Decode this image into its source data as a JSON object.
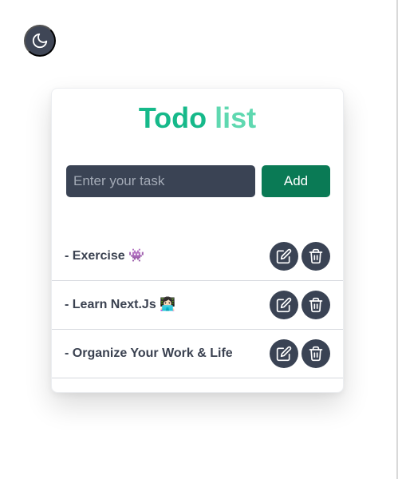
{
  "theme_toggle": {
    "icon": "moon-icon"
  },
  "header": {
    "title_part1": "Todo",
    "title_part2": "list",
    "title_colors": {
      "part1": "#16b98a",
      "part2": "#5fd8b0"
    }
  },
  "form": {
    "placeholder": "Enter your task",
    "value": "",
    "add_label": "Add"
  },
  "tasks": [
    {
      "text": "- Exercise 👾"
    },
    {
      "text": "- Learn Next.Js 👩🏻‍💻"
    },
    {
      "text": "- Organize Your Work & Life"
    }
  ],
  "task_actions": {
    "edit_icon": "edit-icon",
    "delete_icon": "trash-icon"
  },
  "colors": {
    "accent": "#0a7a55",
    "dark": "#3a4354"
  }
}
